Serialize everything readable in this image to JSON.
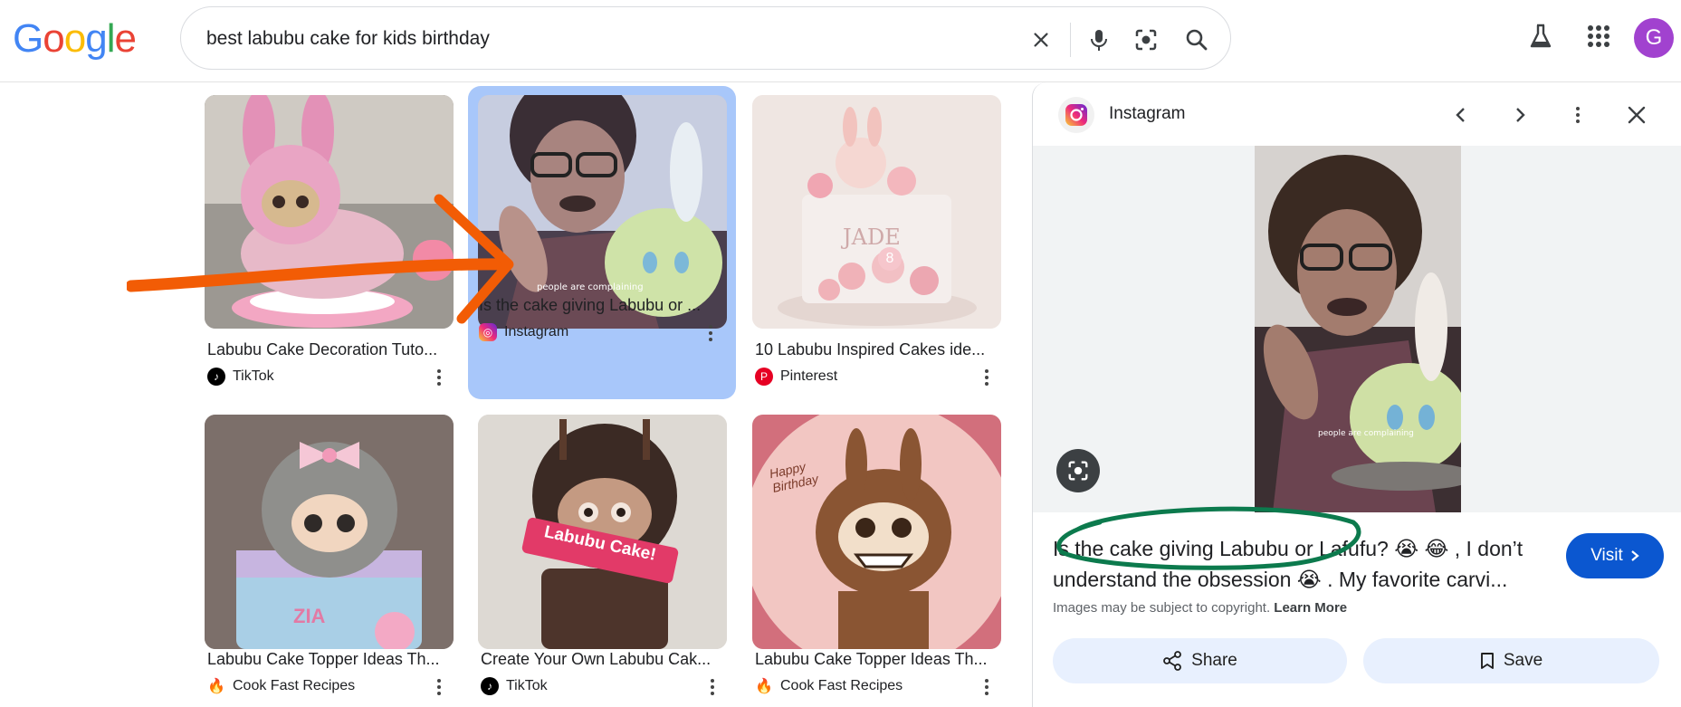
{
  "search": {
    "query": "best labubu cake for kids birthday"
  },
  "logo": [
    "G",
    "o",
    "o",
    "g",
    "l",
    "e"
  ],
  "logo_colors": [
    "#4285F4",
    "#EA4335",
    "#FBBC05",
    "#4285F4",
    "#34A853",
    "#EA4335"
  ],
  "account": {
    "initial": "G"
  },
  "results": [
    {
      "title": "Labubu Cake Decoration Tuto...",
      "source": "TikTok"
    },
    {
      "title": "Is the cake giving Labubu or ...",
      "source": "Instagram"
    },
    {
      "title": "10 Labubu Inspired Cakes ide...",
      "source": "Pinterest"
    },
    {
      "title": "Labubu Cake Topper Ideas Th...",
      "source": "Cook Fast Recipes"
    },
    {
      "title": "Create Your Own Labubu Cak...",
      "source": "TikTok"
    },
    {
      "title": "Labubu Cake Topper Ideas Th...",
      "source": "Cook Fast Recipes"
    }
  ],
  "thumb_captions": {
    "result_5_banner": "Labubu Cake!",
    "result_3_plate": "8",
    "result_4_name": "ZIA",
    "result_6_writing": "Happy Birthday"
  },
  "panel": {
    "source": "Instagram",
    "description": "Is the cake giving Labubu or Lafufu? 😭 😂 , I don’t understand the obsession 😭 . My favorite carvi...",
    "visit_label": "Visit",
    "copyright_text": "Images may be subject to copyright.",
    "learn_more": "Learn More",
    "share_label": "Share",
    "save_label": "Save"
  },
  "colors": {
    "selected_card": "#a8c7fa",
    "visit_button": "#0b57d0",
    "annotation_arrow": "#f25c05",
    "annotation_circle": "#0c7a4d"
  }
}
